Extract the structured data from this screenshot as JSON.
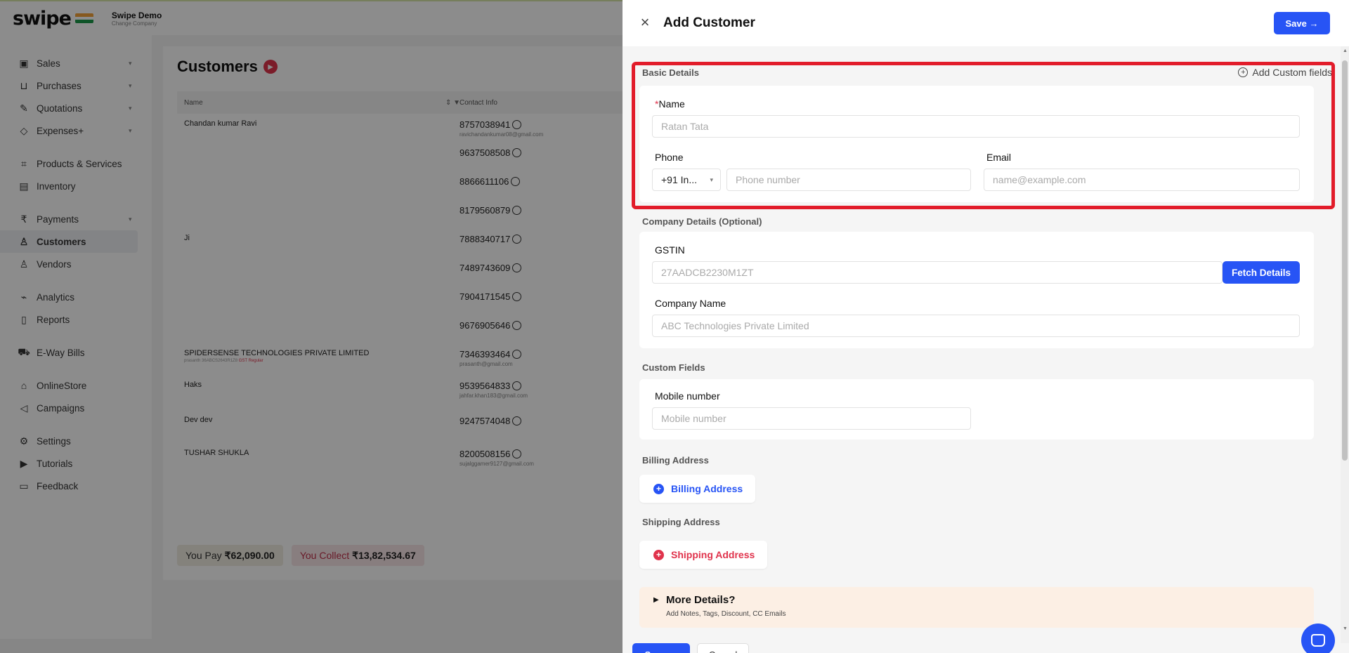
{
  "app": {
    "brand": "swipe",
    "company_name": "Swipe Demo",
    "company_sub": "Change Company"
  },
  "sidebar": {
    "items": [
      {
        "label": "Sales",
        "icon": "sales-icon"
      },
      {
        "label": "Purchases",
        "icon": "cart-icon"
      },
      {
        "label": "Quotations",
        "icon": "pen-icon"
      },
      {
        "label": "Expenses+",
        "icon": "tag-icon"
      },
      {
        "label": "Products & Services",
        "icon": "box-icon"
      },
      {
        "label": "Inventory",
        "icon": "inventory-icon"
      },
      {
        "label": "Payments",
        "icon": "rupee-icon"
      },
      {
        "label": "Customers",
        "icon": "user-icon"
      },
      {
        "label": "Vendors",
        "icon": "users-icon"
      },
      {
        "label": "Analytics",
        "icon": "chart-icon"
      },
      {
        "label": "Reports",
        "icon": "report-icon"
      },
      {
        "label": "E-Way Bills",
        "icon": "truck-icon"
      },
      {
        "label": "OnlineStore",
        "icon": "store-icon"
      },
      {
        "label": "Campaigns",
        "icon": "megaphone-icon"
      },
      {
        "label": "Settings",
        "icon": "gear-icon"
      },
      {
        "label": "Tutorials",
        "icon": "video-icon"
      },
      {
        "label": "Feedback",
        "icon": "chat-icon"
      }
    ]
  },
  "customers": {
    "title": "Customers",
    "col_name": "Name",
    "col_contact": "Contact Info",
    "rows": [
      {
        "name": "Chandan kumar Ravi",
        "sub": "",
        "tag": "",
        "phone": "8757038941",
        "email": "ravichandankumar08@gmail.com"
      },
      {
        "name": "",
        "sub": "",
        "tag": "",
        "phone": "9637508508",
        "email": ""
      },
      {
        "name": "",
        "sub": "",
        "tag": "",
        "phone": "8866611106",
        "email": ""
      },
      {
        "name": "",
        "sub": "",
        "tag": "",
        "phone": "8179560879",
        "email": ""
      },
      {
        "name": "Ji",
        "sub": "",
        "tag": "",
        "phone": "7888340717",
        "email": ""
      },
      {
        "name": "",
        "sub": "",
        "tag": "",
        "phone": "7489743609",
        "email": ""
      },
      {
        "name": "",
        "sub": "",
        "tag": "",
        "phone": "7904171545",
        "email": ""
      },
      {
        "name": "",
        "sub": "",
        "tag": "",
        "phone": "9676905646",
        "email": ""
      },
      {
        "name": "SPIDERSENSE TECHNOLOGIES PRIVATE LIMITED",
        "sub": "prasanth 36ABCS2643R1Z8",
        "tag": "GST Regular",
        "phone": "7346393464",
        "email": "prasanth@gmail.com"
      },
      {
        "name": "Haks",
        "sub": "",
        "tag": "",
        "phone": "9539564833",
        "email": "jahfar.khan183@gmail.com"
      },
      {
        "name": "Dev dev",
        "sub": "",
        "tag": "",
        "phone": "9247574048",
        "email": ""
      },
      {
        "name": "TUSHAR SHUKLA",
        "sub": "",
        "tag": "",
        "phone": "8200508156",
        "email": "sujalggamer9127@gmail.com"
      }
    ],
    "you_pay_label": "You Pay",
    "you_pay_value": "₹62,090.00",
    "you_collect_label": "You Collect",
    "you_collect_value": "₹13,82,534.67"
  },
  "drawer": {
    "title": "Add Customer",
    "save_label": "Save →",
    "basic_details": "Basic Details",
    "add_custom_fields": "Add Custom fields",
    "name_label": "Name",
    "name_required_mark": "*",
    "name_placeholder": "Ratan Tata",
    "phone_label": "Phone",
    "country_code": "+91 In...",
    "phone_placeholder": "Phone number",
    "email_label": "Email",
    "email_placeholder": "name@example.com",
    "company_details": "Company Details (Optional)",
    "gstin_label": "GSTIN",
    "gstin_placeholder": "27AADCB2230M1ZT",
    "fetch_label": "Fetch Details",
    "company_name_label": "Company Name",
    "company_name_placeholder": "ABC Technologies Private Limited",
    "custom_fields": "Custom Fields",
    "mobile_label": "Mobile number",
    "mobile_placeholder": "Mobile number",
    "billing_section": "Billing Address",
    "billing_button": "Billing Address",
    "shipping_section": "Shipping Address",
    "shipping_button": "Shipping Address",
    "more_title": "More Details?",
    "more_sub": "Add Notes, Tags, Discount, CC Emails",
    "footer_save": "Save →",
    "footer_cancel": "Cancel"
  },
  "colors": {
    "primary": "#2754f5",
    "danger": "#e0334c",
    "highlight": "#e21c2a"
  }
}
